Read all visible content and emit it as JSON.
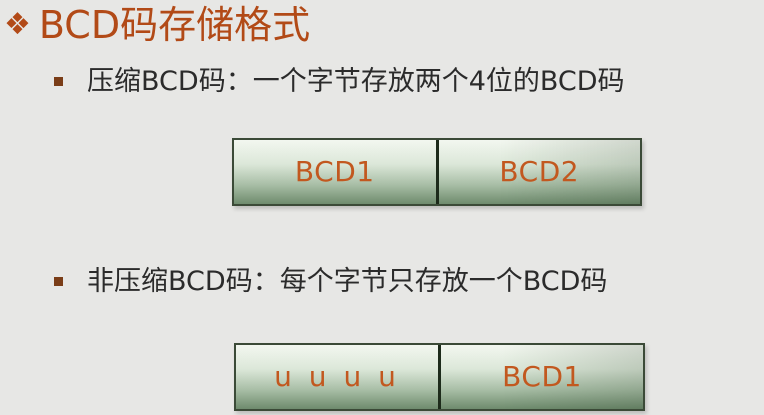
{
  "slide": {
    "title_icon": "diamond-cluster-icon",
    "title": "BCD码存储格式",
    "accent_color": "#b24a17",
    "bullets": [
      {
        "text": "压缩BCD码：一个字节存放两个4位的BCD码",
        "diagram": {
          "left": "BCD1",
          "right": "BCD2"
        }
      },
      {
        "text": "非压缩BCD码：每个字节只存放一个BCD码",
        "diagram": {
          "left": "u u u u",
          "right": "BCD1"
        }
      }
    ]
  }
}
